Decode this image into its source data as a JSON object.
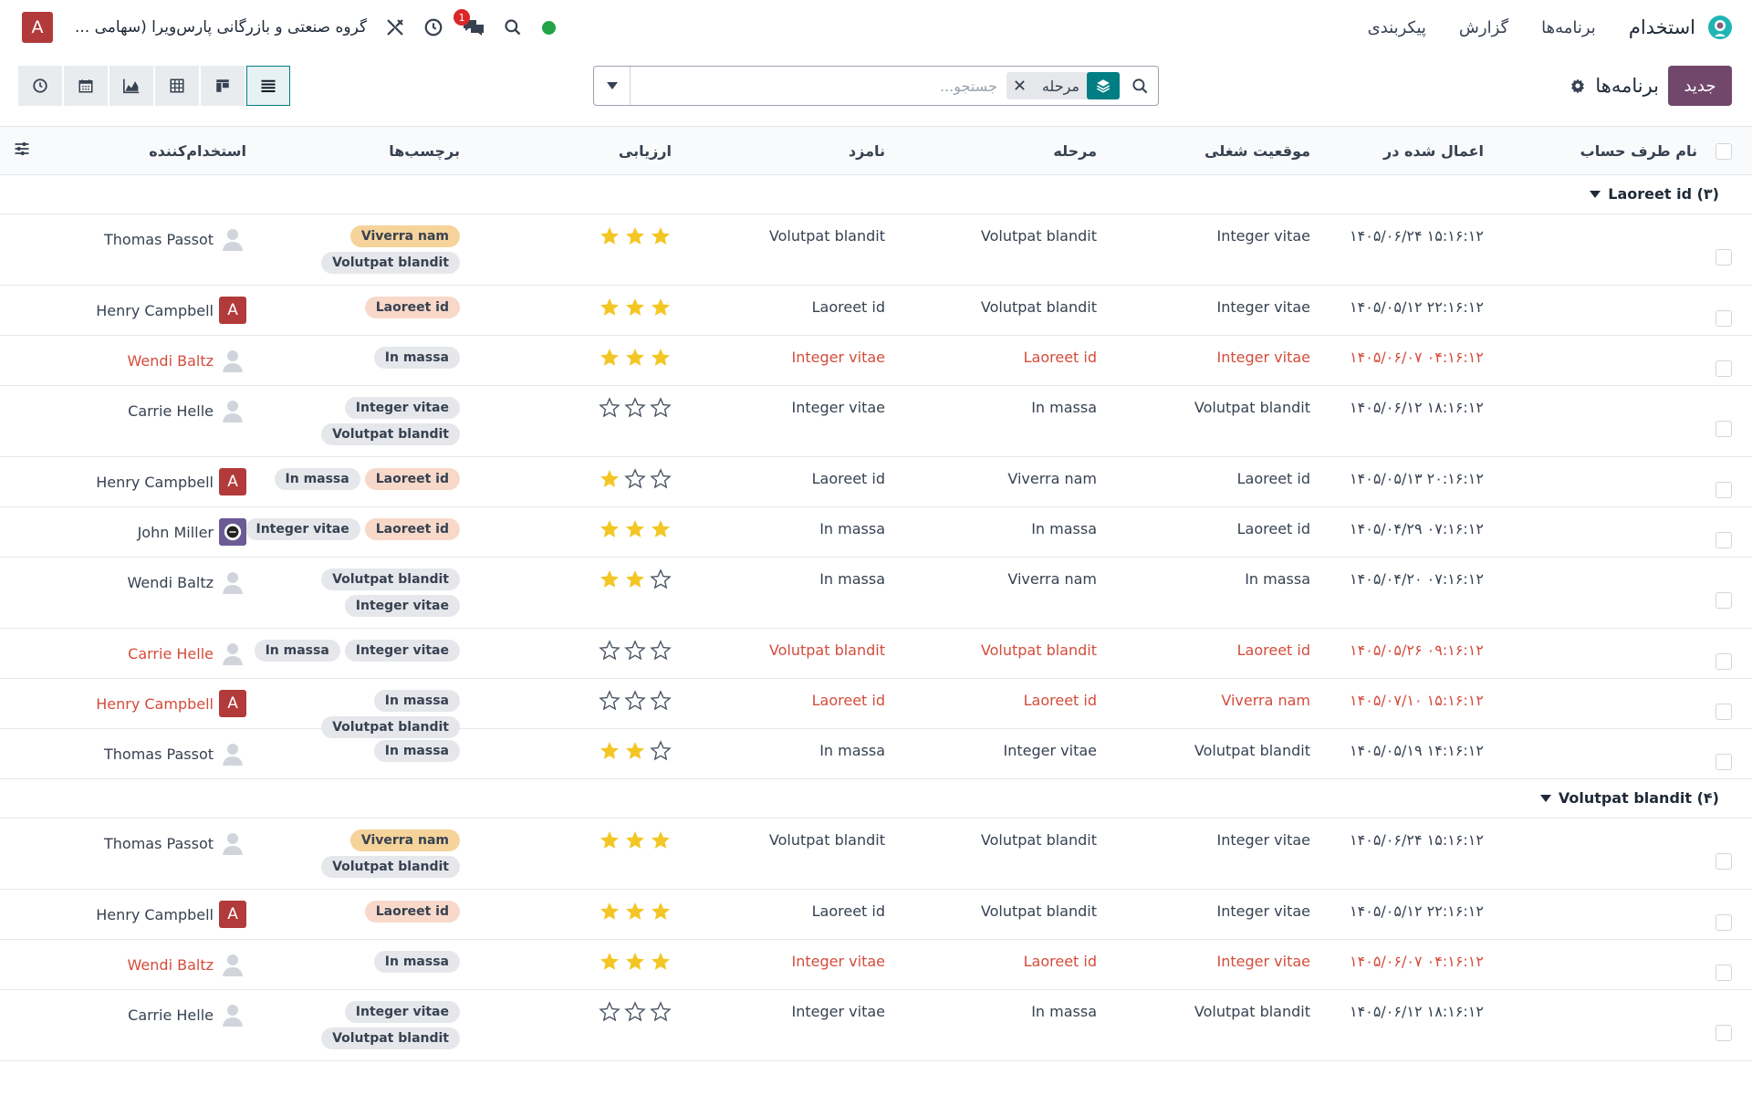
{
  "colors": {
    "brand": "#71486b",
    "accent": "#017e84",
    "danger": "#d44c3b",
    "star": "#f3c623",
    "dot": "#22a447",
    "avatar": "#b23a3a"
  },
  "navbar": {
    "app_title": "استخدام",
    "menu": [
      "برنامه‌ها",
      "گزارش",
      "پیکربندی"
    ],
    "company": "گروه صنعتی و بازرگانی پارس‌ویرا (سهامی ...",
    "user_initial": "A",
    "notification_count": "1"
  },
  "control": {
    "new_label": "جدید",
    "breadcrumb": "برنامه‌ها",
    "facet_label": "مرحله",
    "search_placeholder": "جستجو..."
  },
  "columns": {
    "account": "نام طرف حساب",
    "applied": "اعمال شده در",
    "job": "موقعیت شغلی",
    "stage": "مرحله",
    "candidate": "نامزد",
    "rating": "ارزیابی",
    "tags": "برچسب‌ها",
    "recruiter": "استخدام‌کننده"
  },
  "tag_colors": {
    "Viverra nam": "#f6d39a",
    "Volutpat blandit": "#e5e7eb",
    "Laoreet id": "#f8d9c9",
    "In massa": "#e5e7eb",
    "Integer vitae": "#e5e7eb"
  },
  "groups": [
    {
      "label": "Laoreet id (۳)",
      "rows": [
        {
          "date": "۱۴۰۵/۰۶/۲۴ ۱۵:۱۶:۱۲",
          "job": "Integer vitae",
          "stage": "Volutpat blandit",
          "candidate": "Volutpat blandit",
          "stars": 3,
          "tags": [
            "Viverra nam",
            "Volutpat blandit"
          ],
          "recruiter": "Thomas Passot",
          "avatar": "person",
          "danger": false
        },
        {
          "date": "۱۴۰۵/۰۵/۱۲ ۲۲:۱۶:۱۲",
          "job": "Integer vitae",
          "stage": "Volutpat blandit",
          "candidate": "Laoreet id",
          "stars": 3,
          "tags": [
            "Laoreet id"
          ],
          "recruiter": "Henry Campbell",
          "avatar": "letter",
          "danger": false
        },
        {
          "date": "۱۴۰۵/۰۶/۰۷ ۰۴:۱۶:۱۲",
          "job": "Integer vitae",
          "stage": "Laoreet id",
          "candidate": "Integer vitae",
          "stars": 3,
          "tags": [
            "In massa"
          ],
          "recruiter": "Wendi Baltz",
          "avatar": "person",
          "danger": true
        },
        {
          "date": "۱۴۰۵/۰۶/۱۲ ۱۸:۱۶:۱۲",
          "job": "Volutpat blandit",
          "stage": "In massa",
          "candidate": "Integer vitae",
          "stars": 0,
          "tags": [
            "Integer vitae",
            "Volutpat blandit"
          ],
          "recruiter": "Carrie Helle",
          "avatar": "person",
          "danger": false
        },
        {
          "date": "۱۴۰۵/۰۵/۱۳ ۲۰:۱۶:۱۲",
          "job": "Laoreet id",
          "stage": "Viverra nam",
          "candidate": "Laoreet id",
          "stars": 1,
          "tags": [
            "Laoreet id",
            "In massa"
          ],
          "recruiter": "Henry Campbell",
          "avatar": "letter",
          "danger": false
        },
        {
          "date": "۱۴۰۵/۰۴/۲۹ ۰۷:۱۶:۱۲",
          "job": "Laoreet id",
          "stage": "In massa",
          "candidate": "In massa",
          "stars": 3,
          "tags": [
            "Laoreet id",
            "Integer vitae"
          ],
          "recruiter": "John Miller",
          "avatar": "photo",
          "danger": false
        },
        {
          "date": "۱۴۰۵/۰۴/۲۰ ۰۷:۱۶:۱۲",
          "job": "In massa",
          "stage": "Viverra nam",
          "candidate": "In massa",
          "stars": 2,
          "tags": [
            "Volutpat blandit",
            "Integer vitae"
          ],
          "recruiter": "Wendi Baltz",
          "avatar": "person",
          "danger": false
        },
        {
          "date": "۱۴۰۵/۰۵/۲۶ ۰۹:۱۶:۱۲",
          "job": "Laoreet id",
          "stage": "Volutpat blandit",
          "candidate": "Volutpat blandit",
          "stars": 0,
          "tags": [
            "Integer vitae",
            "In massa"
          ],
          "recruiter": "Carrie Helle",
          "avatar": "person",
          "danger": true
        },
        {
          "date": "۱۴۰۵/۰۷/۱۰ ۱۵:۱۶:۱۲",
          "job": "Viverra nam",
          "stage": "Laoreet id",
          "candidate": "Laoreet id",
          "stars": 0,
          "tags": [
            "In massa",
            "Volutpat blandit"
          ],
          "recruiter": "Henry Campbell",
          "avatar": "letter",
          "danger": true
        },
        {
          "date": "۱۴۰۵/۰۵/۱۹ ۱۴:۱۶:۱۲",
          "job": "Volutpat blandit",
          "stage": "Integer vitae",
          "candidate": "In massa",
          "stars": 2,
          "tags": [
            "In massa"
          ],
          "recruiter": "Thomas Passot",
          "avatar": "person",
          "danger": false
        }
      ]
    },
    {
      "label": "Volutpat blandit (۴)",
      "rows": [
        {
          "date": "۱۴۰۵/۰۶/۲۴ ۱۵:۱۶:۱۲",
          "job": "Integer vitae",
          "stage": "Volutpat blandit",
          "candidate": "Volutpat blandit",
          "stars": 3,
          "tags": [
            "Viverra nam",
            "Volutpat blandit"
          ],
          "recruiter": "Thomas Passot",
          "avatar": "person",
          "danger": false
        },
        {
          "date": "۱۴۰۵/۰۵/۱۲ ۲۲:۱۶:۱۲",
          "job": "Integer vitae",
          "stage": "Volutpat blandit",
          "candidate": "Laoreet id",
          "stars": 3,
          "tags": [
            "Laoreet id"
          ],
          "recruiter": "Henry Campbell",
          "avatar": "letter",
          "danger": false
        },
        {
          "date": "۱۴۰۵/۰۶/۰۷ ۰۴:۱۶:۱۲",
          "job": "Integer vitae",
          "stage": "Laoreet id",
          "candidate": "Integer vitae",
          "stars": 3,
          "tags": [
            "In massa"
          ],
          "recruiter": "Wendi Baltz",
          "avatar": "person",
          "danger": true
        },
        {
          "date": "۱۴۰۵/۰۶/۱۲ ۱۸:۱۶:۱۲",
          "job": "Volutpat blandit",
          "stage": "In massa",
          "candidate": "Integer vitae",
          "stars": 0,
          "tags": [
            "Integer vitae",
            "Volutpat blandit"
          ],
          "recruiter": "Carrie Helle",
          "avatar": "person",
          "danger": false
        }
      ]
    }
  ]
}
